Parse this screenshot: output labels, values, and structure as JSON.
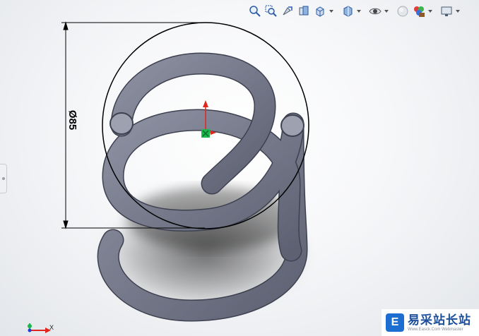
{
  "toolbar": {
    "buttons": [
      {
        "name": "zoom-to-fit-icon",
        "dropdown": false
      },
      {
        "name": "zoom-to-area-icon",
        "dropdown": false
      },
      {
        "name": "previous-view-icon",
        "dropdown": false
      },
      {
        "name": "section-view-icon",
        "dropdown": false
      },
      {
        "name": "view-orientation-icon",
        "dropdown": true
      },
      {
        "name": "display-style-icon",
        "dropdown": true
      },
      {
        "name": "hide-show-items-icon",
        "dropdown": true
      },
      {
        "name": "edit-appearance-icon",
        "dropdown": false
      },
      {
        "name": "apply-scene-icon",
        "dropdown": true
      },
      {
        "name": "view-settings-icon",
        "dropdown": true
      }
    ]
  },
  "dimension": {
    "label": "Ø85",
    "value": 85
  },
  "triad": {
    "x_label": "X"
  },
  "watermark": {
    "logo_letter": "E",
    "name": "易采站长站",
    "subtitle": "Www.Easck.Com Webmaster"
  },
  "colors": {
    "spring_body": "#6b6f80",
    "spring_highlight": "#9da1b0",
    "dimension_line": "#000000",
    "origin_green": "#19b84a",
    "axis_red": "#e0261f",
    "watermark_blue": "#1c6fd1"
  }
}
